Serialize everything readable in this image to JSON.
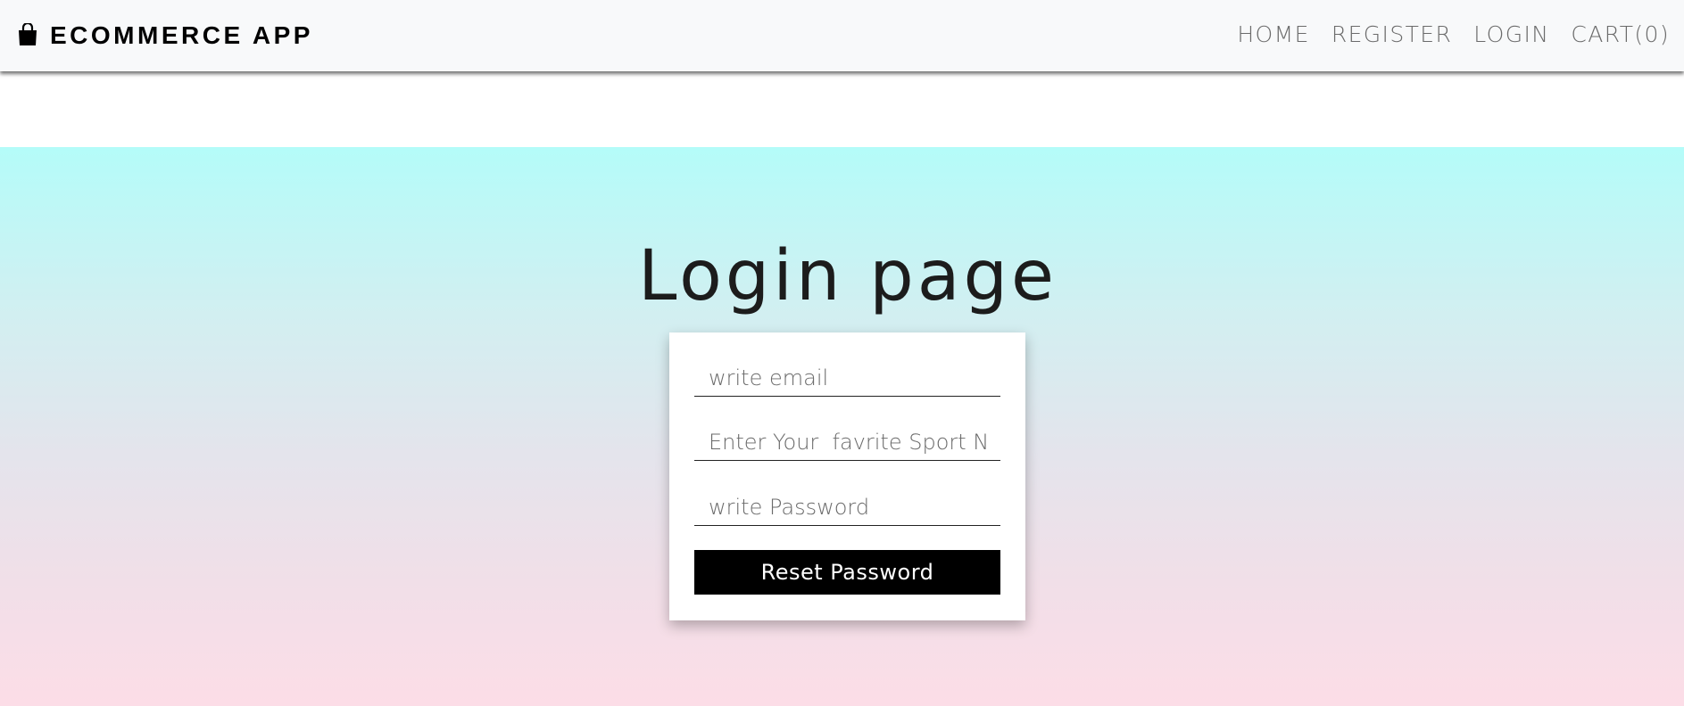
{
  "navbar": {
    "brand": "ECOMMERCE APP",
    "brand_icon": "shopping-bag-icon",
    "links": {
      "home": "HOME",
      "register": "REGISTER",
      "login": "LOGIN",
      "cart": "CART(0)"
    }
  },
  "main": {
    "title": "Login page",
    "form": {
      "email_placeholder": "write email",
      "sport_placeholder": "Enter Your  favrite Sport Name",
      "password_placeholder": "write Password",
      "submit_label": "Reset Password"
    }
  },
  "colors": {
    "gradient_top": "#b4fcf9",
    "gradient_bottom": "#fcdde7",
    "button_bg": "#000000",
    "navbar_bg": "#f8f9fa"
  }
}
